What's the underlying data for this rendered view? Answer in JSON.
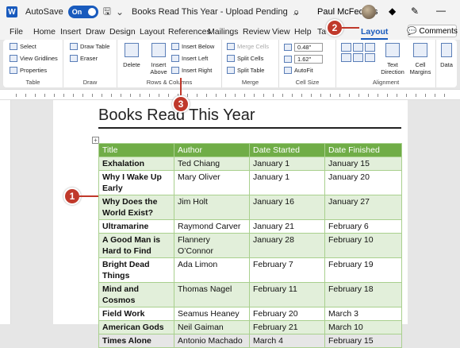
{
  "titlebar": {
    "word_logo": "W",
    "autosave_label": "AutoSave",
    "autosave_state": "On",
    "doc_title": "Books Read This Year - Upload Pending",
    "doc_title_chevron": "⌄",
    "user": "Paul McFedries"
  },
  "menu": {
    "tabs": [
      "File",
      "Home",
      "Insert",
      "Draw",
      "Design",
      "Layout",
      "References",
      "Mailings",
      "Review",
      "View",
      "Help",
      "Ta"
    ],
    "active": "Layout",
    "comments_label": "Comments"
  },
  "ribbon": {
    "table": {
      "label": "Table",
      "select": "Select",
      "view_gridlines": "View Gridlines",
      "properties": "Properties"
    },
    "draw": {
      "label": "Draw",
      "draw_table": "Draw Table",
      "eraser": "Eraser"
    },
    "rows_columns": {
      "label": "Rows & Columns",
      "delete": "Delete",
      "insert_above": "Insert Above",
      "insert_below": "Insert Below",
      "insert_left": "Insert Left",
      "insert_right": "Insert Right"
    },
    "merge": {
      "label": "Merge",
      "merge_cells": "Merge Cells",
      "split_cells": "Split Cells",
      "split_table": "Split Table"
    },
    "cell_size": {
      "label": "Cell Size",
      "height": "0.48\"",
      "width": "1.62\"",
      "autofit": "AutoFit"
    },
    "alignment": {
      "label": "Alignment",
      "text_direction": "Text Direction",
      "cell_margins": "Cell Margins"
    },
    "data": {
      "label": "Data"
    }
  },
  "document": {
    "heading": "Books Read This Year",
    "columns": [
      "Title",
      "Author",
      "Date Started",
      "Date Finished"
    ],
    "rows": [
      [
        "Exhalation",
        "Ted Chiang",
        "January 1",
        "January 15"
      ],
      [
        "Why I Wake Up Early",
        "Mary Oliver",
        "January 1",
        "January 20"
      ],
      [
        "Why Does the World Exist?",
        "Jim Holt",
        "January 16",
        "January 27"
      ],
      [
        "Ultramarine",
        "Raymond Carver",
        "January 21",
        "February 6"
      ],
      [
        "A Good Man is Hard to Find",
        "Flannery O’Connor",
        "January 28",
        "February 10"
      ],
      [
        "Bright Dead Things",
        "Ada Limon",
        "February 7",
        "February 19"
      ],
      [
        "Mind and Cosmos",
        "Thomas Nagel",
        "February 11",
        "February 18"
      ],
      [
        "Field Work",
        "Seamus Heaney",
        "February 20",
        "March 3"
      ],
      [
        "American Gods",
        "Neil Gaiman",
        "February 21",
        "March 10"
      ],
      [
        "Times Alone",
        "Antonio Machado",
        "March 4",
        "February 15"
      ]
    ]
  },
  "callouts": {
    "one": "1",
    "two": "2",
    "three": "3"
  },
  "colors": {
    "accent": "#185abd",
    "table_header": "#70ad47",
    "table_alt": "#e2efda",
    "callout": "#c0392b"
  }
}
